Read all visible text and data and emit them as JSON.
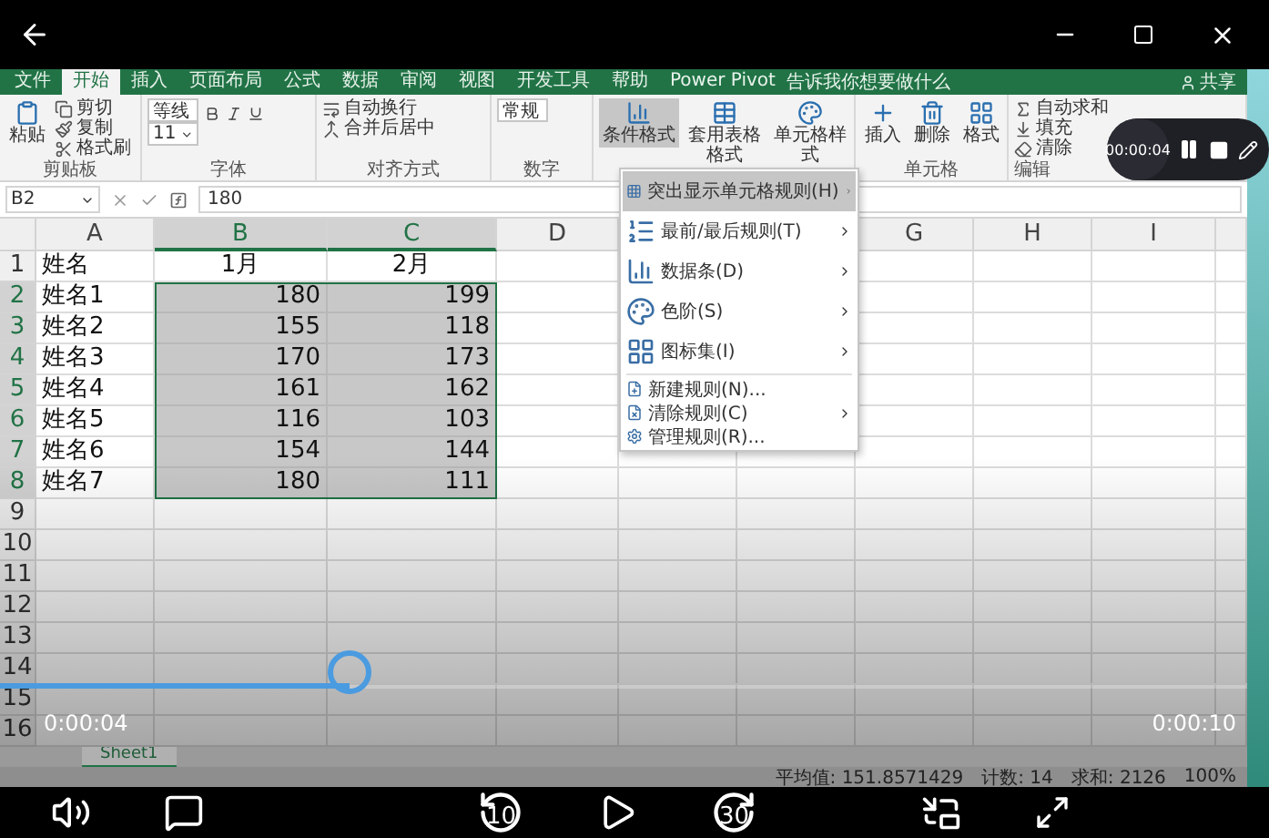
{
  "excel": {
    "tabs": [
      {
        "label": "文件",
        "selected": false
      },
      {
        "label": "开始",
        "selected": true
      },
      {
        "label": "插入",
        "selected": false
      },
      {
        "label": "页面布局",
        "selected": false
      },
      {
        "label": "公式",
        "selected": false
      },
      {
        "label": "数据",
        "selected": false
      },
      {
        "label": "审阅",
        "selected": false
      },
      {
        "label": "视图",
        "selected": false
      },
      {
        "label": "开发工具",
        "selected": false
      },
      {
        "label": "帮助",
        "selected": false
      },
      {
        "label": "Power Pivot",
        "selected": false
      }
    ],
    "tell_me": "告诉我你想要做什么",
    "share": "共享",
    "ribbon": [
      {
        "label": "剪贴板",
        "items": [
          {
            "kind": "big",
            "text": "粘贴",
            "selected": false
          },
          {
            "kind": "small",
            "text": "剪切"
          },
          {
            "kind": "small",
            "text": "复制"
          },
          {
            "kind": "small",
            "text": "格式刷"
          }
        ]
      },
      {
        "label": "字体",
        "items": [
          {
            "kind": "combo",
            "text": "等线"
          },
          {
            "kind": "combo",
            "text": "11"
          }
        ]
      },
      {
        "label": "对齐方式",
        "items": [
          {
            "kind": "small",
            "text": "自动换行"
          },
          {
            "kind": "small",
            "text": "合并后居中"
          }
        ]
      },
      {
        "label": "数字",
        "items": [
          {
            "kind": "combo",
            "text": "常规"
          }
        ]
      },
      {
        "items": [
          {
            "kind": "big",
            "text": "条件格式",
            "selected": true
          },
          {
            "kind": "big",
            "text": "套用表格格式",
            "selected": false
          },
          {
            "kind": "big",
            "text": "单元格样式",
            "selected": false
          }
        ]
      },
      {
        "label": "单元格",
        "items": [
          {
            "kind": "big",
            "text": "插入",
            "selected": false
          },
          {
            "kind": "big",
            "text": "删除",
            "selected": false
          },
          {
            "kind": "big",
            "text": "格式",
            "selected": false
          }
        ]
      },
      {
        "label": "编辑",
        "items": [
          {
            "kind": "small",
            "text": "自动求和"
          },
          {
            "kind": "small",
            "text": "填充"
          },
          {
            "kind": "small",
            "text": "清除"
          }
        ]
      }
    ],
    "name_box": "B2",
    "formula": "180",
    "columns": [
      {
        "label": "A",
        "selected": false
      },
      {
        "label": "B",
        "selected": true
      },
      {
        "label": "C",
        "selected": true
      },
      {
        "label": "D",
        "selected": false
      },
      {},
      {},
      {
        "label": "G",
        "selected": false
      },
      {
        "label": "H",
        "selected": false
      },
      {
        "label": "I",
        "selected": false
      }
    ],
    "rows": [
      {
        "num": "1",
        "selected": false,
        "cells": [
          "姓名",
          "1月",
          "2月"
        ]
      },
      {
        "num": "2",
        "selected": true,
        "cells": [
          "姓名1",
          "180",
          "199"
        ]
      },
      {
        "num": "3",
        "selected": true,
        "cells": [
          "姓名2",
          "155",
          "118"
        ]
      },
      {
        "num": "4",
        "selected": true,
        "cells": [
          "姓名3",
          "170",
          "173"
        ]
      },
      {
        "num": "5",
        "selected": true,
        "cells": [
          "姓名4",
          "161",
          "162"
        ]
      },
      {
        "num": "6",
        "selected": true,
        "cells": [
          "姓名5",
          "116",
          "103"
        ]
      },
      {
        "num": "7",
        "selected": true,
        "cells": [
          "姓名6",
          "154",
          "144"
        ]
      },
      {
        "num": "8",
        "selected": true,
        "cells": [
          "姓名7",
          "180",
          "111"
        ]
      },
      {
        "num": "9",
        "selected": false,
        "cells": []
      },
      {
        "num": "10",
        "selected": false,
        "cells": []
      },
      {
        "num": "11",
        "selected": false,
        "cells": []
      },
      {
        "num": "12",
        "selected": false,
        "cells": []
      },
      {
        "num": "13",
        "selected": false,
        "cells": []
      },
      {
        "num": "14",
        "selected": false,
        "cells": []
      },
      {
        "num": "15",
        "selected": false,
        "cells": []
      },
      {
        "num": "16",
        "selected": false,
        "cells": []
      }
    ],
    "menu": [
      {
        "kind": "large",
        "label": "突出显示单元格规则(H)",
        "submenu": true,
        "selected": true
      },
      {
        "kind": "large",
        "label": "最前/最后规则(T)",
        "submenu": true,
        "selected": false
      },
      {
        "kind": "large",
        "label": "数据条(D)",
        "submenu": true,
        "selected": false
      },
      {
        "kind": "large",
        "label": "色阶(S)",
        "submenu": true,
        "selected": false
      },
      {
        "kind": "large",
        "label": "图标集(I)",
        "submenu": true,
        "selected": false
      },
      {
        "kind": "small",
        "label": "新建规则(N)...",
        "submenu": false,
        "selected": false
      },
      {
        "kind": "small",
        "label": "清除规则(C)",
        "submenu": true,
        "selected": false
      },
      {
        "kind": "small",
        "label": "管理规则(R)...",
        "submenu": false,
        "selected": false
      }
    ],
    "sheets": [
      {
        "label": "Sheet1",
        "selected": true
      }
    ],
    "status": {
      "stats": [
        "平均值: 151.8571429",
        "计数: 14",
        "求和: 2126"
      ],
      "zoom": "100%"
    }
  },
  "recorder": {
    "time": "00:00:04"
  },
  "player": {
    "elapsed": "0:00:04",
    "total": "0:00:10",
    "level": 0.28,
    "rewind": "10",
    "forward": "30"
  }
}
